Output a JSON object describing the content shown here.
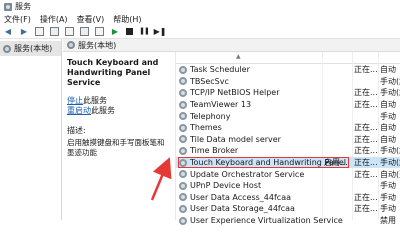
{
  "window": {
    "title": "服务"
  },
  "menubar": {
    "items": [
      "文件(F)",
      "操作(A)",
      "查看(V)",
      "帮助(H)"
    ]
  },
  "sidebar": {
    "items": [
      {
        "label": "服务(本地)"
      }
    ]
  },
  "main": {
    "header": "服务(本地)"
  },
  "details": {
    "service_title": "Touch Keyboard and Handwriting Panel Service",
    "link_stop": "停止",
    "link_stop_suffix": "此服务",
    "link_restart": "重启动",
    "link_restart_suffix": "此服务",
    "description_label": "描述:",
    "description_text": "启用触摸键盘和手写面板笔和墨迹功能"
  },
  "services": [
    {
      "name": "Task Scheduler",
      "c2": "",
      "c3": "正在...",
      "c4": "自动"
    },
    {
      "name": "TBSecSvc",
      "c2": "",
      "c3": "",
      "c4": "手动(触"
    },
    {
      "name": "TCP/IP NetBIOS Helper",
      "c2": "",
      "c3": "正在...",
      "c4": "手动(触"
    },
    {
      "name": "TeamViewer 13",
      "c2": "",
      "c3": "正在...",
      "c4": "自动"
    },
    {
      "name": "Telephony",
      "c2": "",
      "c3": "",
      "c4": "手动"
    },
    {
      "name": "Themes",
      "c2": "",
      "c3": "正在...",
      "c4": "自动"
    },
    {
      "name": "Tile Data model server",
      "c2": "",
      "c3": "正在...",
      "c4": "自动"
    },
    {
      "name": "Time Broker",
      "c2": "",
      "c3": "正在...",
      "c4": "手动(触"
    },
    {
      "name": "Touch Keyboard and Handwriting Panel",
      "c2": "启用...",
      "c3": "正在...",
      "c4": "手动(触"
    },
    {
      "name": "Update Orchestrator Service",
      "c2": "",
      "c3": "正在...",
      "c4": "自动(延"
    },
    {
      "name": "UPnP Device Host",
      "c2": "",
      "c3": "",
      "c4": "手动"
    },
    {
      "name": "User Data Access_44fcaa",
      "c2": "",
      "c3": "正在...",
      "c4": "手动"
    },
    {
      "name": "User Data Storage_44fcaa",
      "c2": "",
      "c3": "正在...",
      "c4": "手动"
    },
    {
      "name": "User Experience Virtualization Service",
      "c2": "",
      "c3": "",
      "c4": "禁用"
    }
  ],
  "selected_index": 8,
  "colors": {
    "selection": "#cce4f7",
    "highlight_box": "#e53935",
    "link": "#1a5fb4",
    "arrow": "#e53935"
  }
}
